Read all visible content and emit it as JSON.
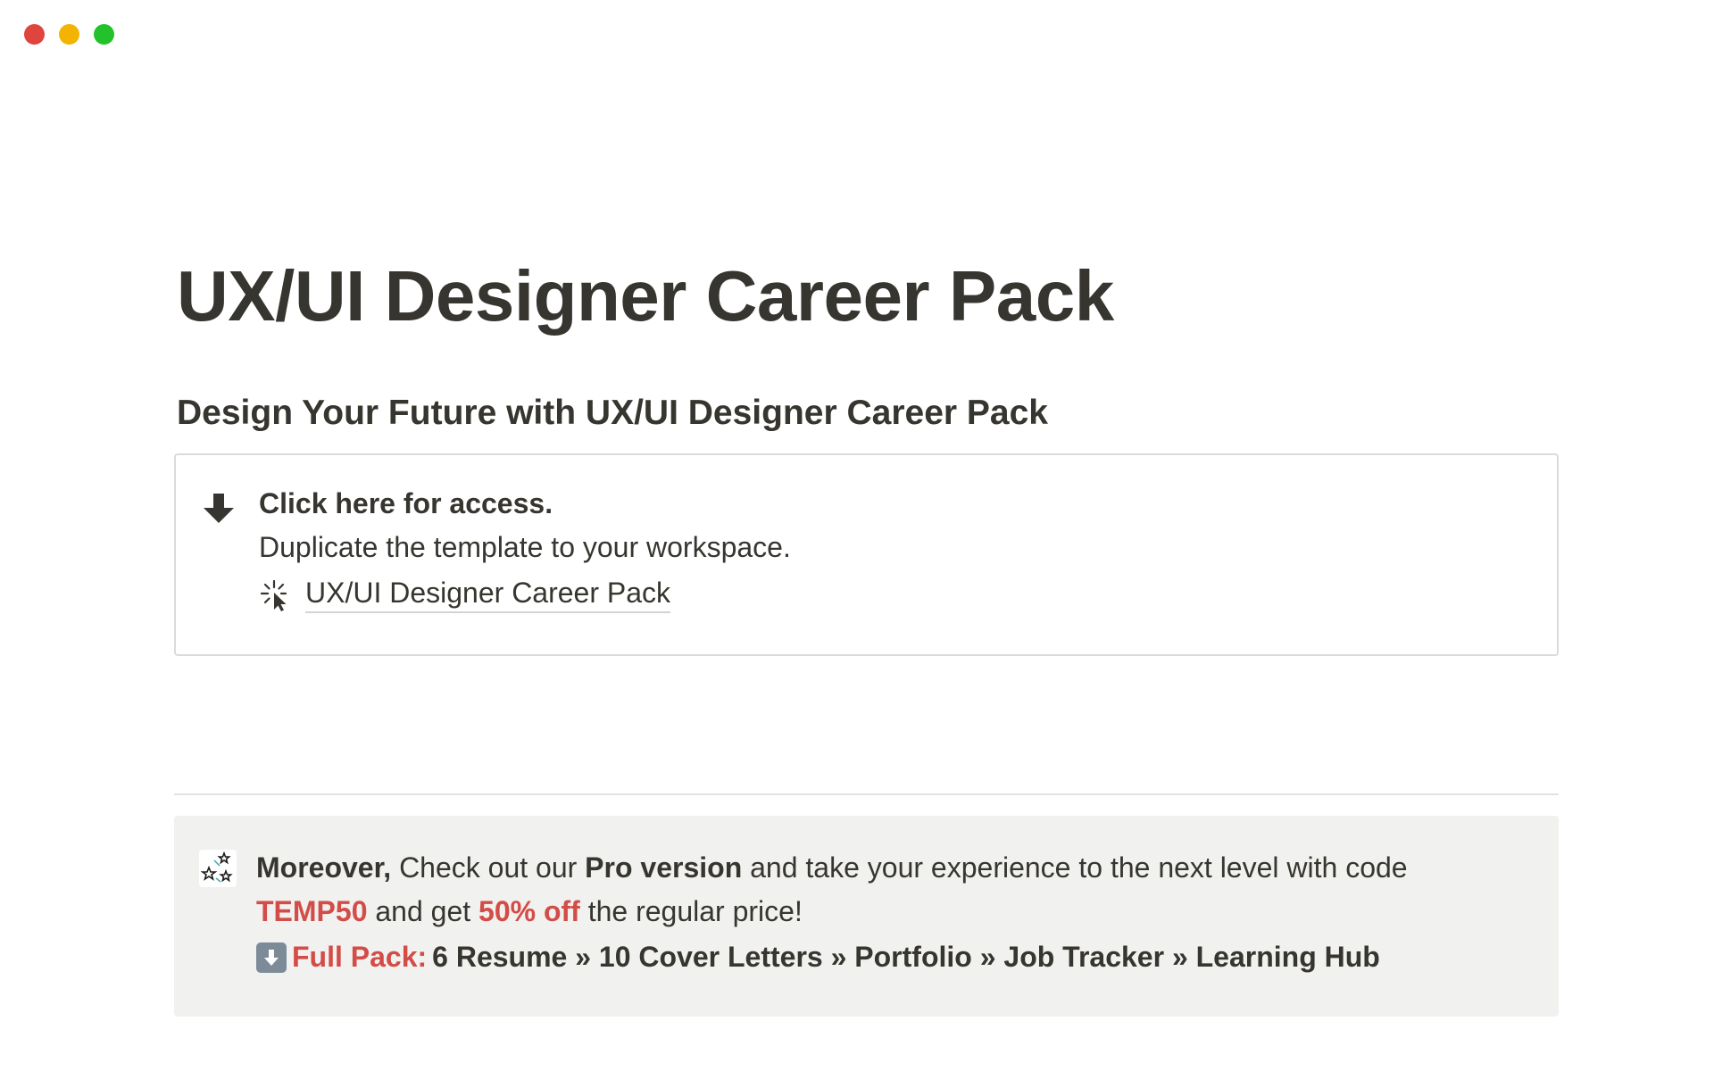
{
  "window": {
    "controls": [
      "close",
      "minimize",
      "maximize"
    ],
    "colors": {
      "close": "#e0443e",
      "minimize": "#f5b301",
      "maximize": "#23c12b"
    }
  },
  "page": {
    "title": "UX/UI Designer Career Pack",
    "subheading": "Design Your Future with UX/UI Designer Career Pack"
  },
  "access_box": {
    "icon": "arrow-down-icon",
    "title": "Click here for access.",
    "description": "Duplicate the template to your workspace.",
    "link_icon": "click-cursor-icon",
    "link_text": "UX/UI Designer Career Pack"
  },
  "callout": {
    "icon": "sparkle-stars-icon",
    "lead": "Moreover,",
    "text_1": " Check out our ",
    "pro_version": "Pro version",
    "text_2": " and take your experience to the next level with code ",
    "code": "TEMP50",
    "text_3": " and get ",
    "discount": "50% off",
    "text_4": " the regular price!",
    "pack_icon": "down-arrow-box-icon",
    "pack_label": "Full Pack:",
    "pack_items": "6 Resume » 10 Cover Letters » Portfolio » Job Tracker » Learning Hub",
    "accent_color": "#d44c47"
  }
}
